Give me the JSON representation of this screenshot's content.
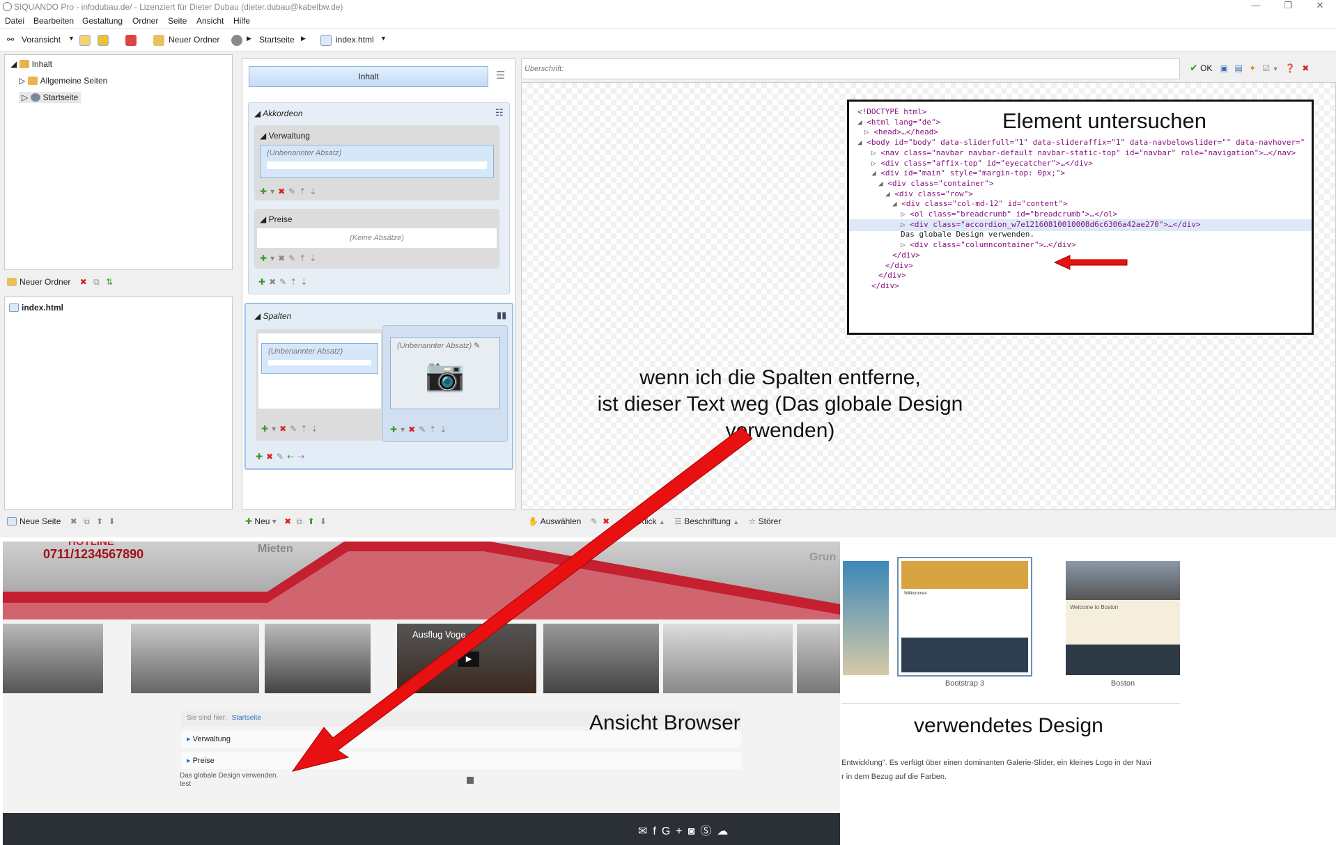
{
  "window": {
    "title": "SIQUANDO Pro - infodubau.de/ - Lizenziert für Dieter Dubau (dieter.dubau@kabelbw.de)"
  },
  "menu": [
    "Datei",
    "Bearbeiten",
    "Gestaltung",
    "Ordner",
    "Seite",
    "Ansicht",
    "Hilfe"
  ],
  "toolbar": {
    "preview": "Voransicht",
    "new_folder": "Neuer Ordner",
    "crumb1": "Startseite",
    "crumb2": "index.html"
  },
  "tree": {
    "root": "Inhalt",
    "item1": "Allgemeine Seiten",
    "item2": "Startseite"
  },
  "left_mid": {
    "new_folder": "Neuer Ordner",
    "file": "index.html"
  },
  "left_bottom": {
    "new_page": "Neue Seite"
  },
  "content": {
    "inhalt_button": "Inhalt",
    "akkordeon": "Akkordeon",
    "verwaltung": "Verwaltung",
    "unnamed": "(Unbenannter Absatz)",
    "preise": "Preise",
    "no_paras": "(Keine Absätze)",
    "spalten": "Spalten",
    "new": "Neu"
  },
  "editor": {
    "heading_placeholder": "Überschrift:",
    "ok": "OK",
    "select": "Auswählen",
    "click": "Klick",
    "caption": "Beschriftung",
    "stoerer": "Störer"
  },
  "inspect": {
    "label": "Element untersuchen",
    "lines": [
      {
        "text": "<!DOCTYPE html>"
      },
      {
        "text": "<html lang=\"de\">"
      },
      {
        "text": "<head>…</head>"
      },
      {
        "text": "<body id=\"body\" data-sliderfull=\"1\" data-slideraffix=\"1\" data-navbelowslider=\"\" data-navhover=\""
      },
      {
        "text": "<nav class=\"navbar navbar-default navbar-static-top\" id=\"navbar\" role=\"navigation\">…</nav>"
      },
      {
        "text": "<div class=\"affix-top\" id=\"eyecatcher\">…</div>"
      },
      {
        "text": "<div id=\"main\" style=\"margin-top: 0px;\">"
      },
      {
        "text": "<div class=\"container\">"
      },
      {
        "text": "<div class=\"row\">"
      },
      {
        "text": "<div class=\"col-md-12\" id=\"content\">"
      },
      {
        "text": "<ol class=\"breadcrumb\" id=\"breadcrumb\">…</ol>"
      },
      {
        "text": "<div class=\"accordion_w7e12160810010008d6c6306a42ae270\">…</div>"
      },
      {
        "text": "Das globale Design verwenden."
      },
      {
        "text": "<div class=\"columncontainer\">…</div>"
      },
      {
        "text": "</div>"
      },
      {
        "text": "</div>"
      },
      {
        "text": "</div>"
      },
      {
        "text": "</div>"
      }
    ]
  },
  "annotation": {
    "line1": "wenn ich die Spalten entferne,",
    "line2": "ist dieser Text weg (Das globale Design",
    "line3": "verwenden)"
  },
  "browser": {
    "label": "Ansicht Browser",
    "hotline": "HOTLINE",
    "phone": "0711/1234567890",
    "nav1": "Mieten",
    "nav2": "Grun",
    "video": "Ausflug Voge",
    "breadcrumb_prefix": "Sie sind hier:",
    "breadcrumb_link": "Startseite",
    "acc1": "Verwaltung",
    "acc2": "Preise",
    "text1": "Das globale Design verwenden.",
    "text2": "test"
  },
  "design": {
    "label": "verwendetes Design",
    "theme1": "Bootstrap 3",
    "theme2": "Boston",
    "theme2_caption": "Welcome to Boston",
    "desc1": "Entwicklung\". Es verfügt über einen dominanten Galerie-Slider, ein kleines Logo in der Navi",
    "desc2": "r in dem Bezug auf die Farben.",
    "thumb1_caption": "Willkommen"
  },
  "colors": {
    "accent_red": "#e81010",
    "selection_blue": "#c4dcf7",
    "footer": "#2b3037"
  }
}
